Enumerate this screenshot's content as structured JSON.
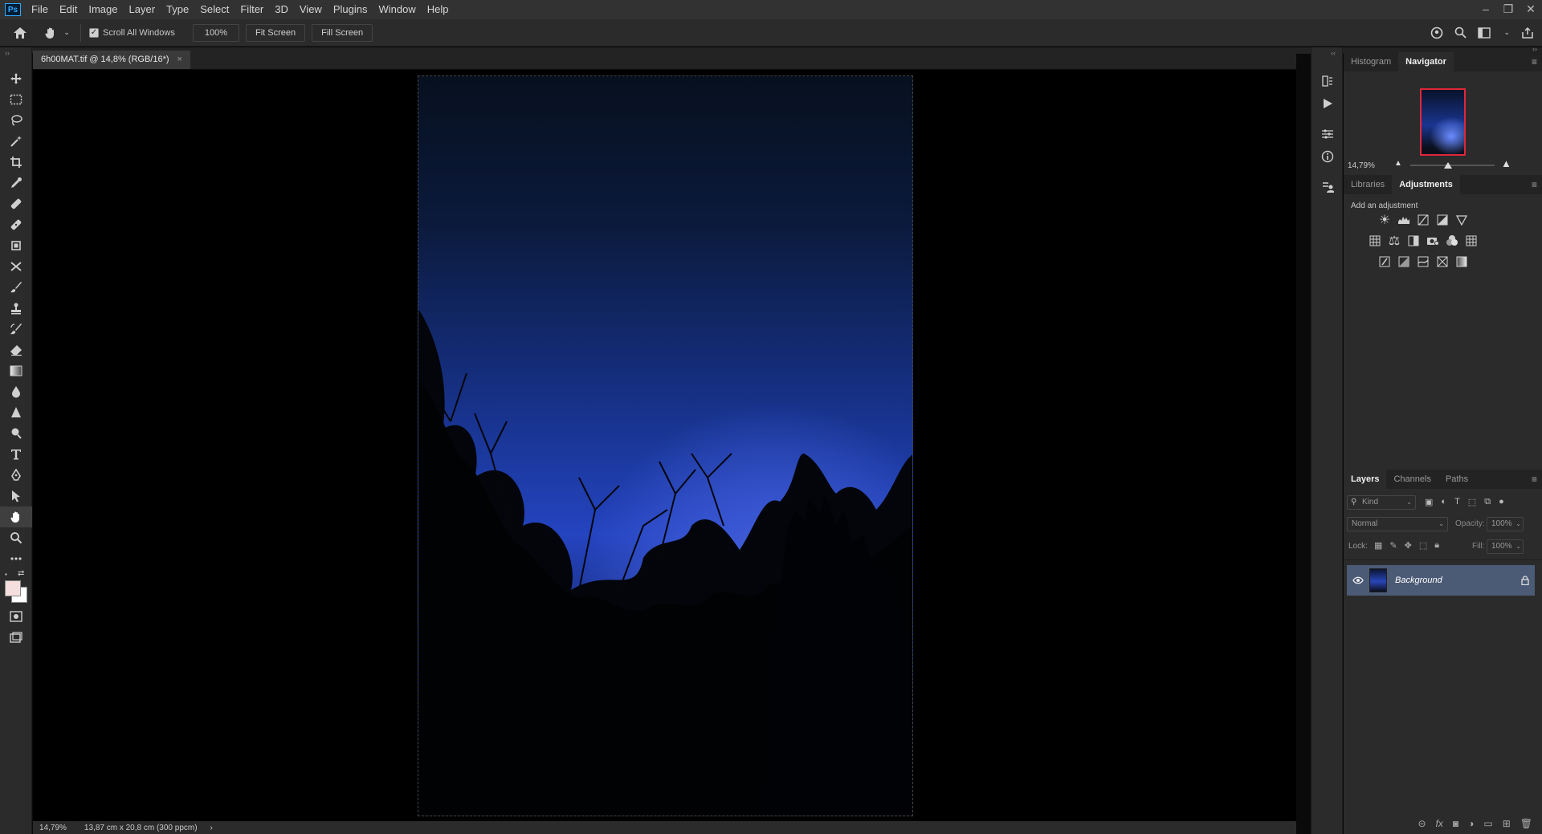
{
  "menu": {
    "logo": "Ps",
    "items": [
      "File",
      "Edit",
      "Image",
      "Layer",
      "Type",
      "Select",
      "Filter",
      "3D",
      "View",
      "Plugins",
      "Window",
      "Help"
    ]
  },
  "options": {
    "scroll_all_windows": "Scroll All Windows",
    "zoom_value": "100%",
    "fit_screen": "Fit Screen",
    "fill_screen": "Fill Screen"
  },
  "document": {
    "tab_title": "6h00MAT.tif @ 14,8% (RGB/16*)",
    "close": "×"
  },
  "status": {
    "zoom": "14,79%",
    "size": "13,87 cm x 20,8 cm (300 ppcm)",
    "arrow": "›"
  },
  "navigator": {
    "tab_histogram": "Histogram",
    "tab_navigator": "Navigator",
    "zoom": "14,79%"
  },
  "adjustments": {
    "tab_libraries": "Libraries",
    "tab_adjustments": "Adjustments",
    "hint": "Add an adjustment"
  },
  "layers": {
    "tab_layers": "Layers",
    "tab_channels": "Channels",
    "tab_paths": "Paths",
    "kind": "Kind",
    "blend_mode": "Normal",
    "opacity_label": "Opacity:",
    "opacity_value": "100%",
    "lock_label": "Lock:",
    "fill_label": "Fill:",
    "fill_value": "100%",
    "layer_name": "Background"
  },
  "colors": {
    "menubar": "#323232",
    "panel": "#2b2b2b",
    "selected_layer": "#4b5a75",
    "nav_frame": "#e0263b"
  }
}
